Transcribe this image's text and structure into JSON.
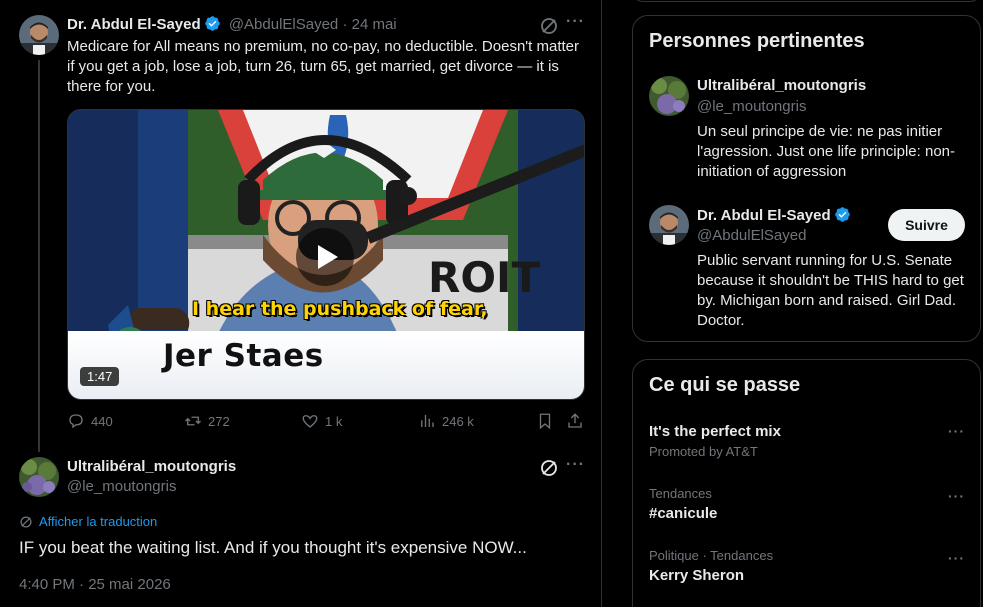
{
  "post1": {
    "author_name": "Dr. Abdul El-Sayed",
    "author_handle": "@AbdulElSayed",
    "date": "· 24 mai",
    "text": "Medicare for All means no premium, no co-pay, no deductible. Doesn't matter if you get a job, lose a job, turn 26, turn 65, get married, get divorce — it is there for you.",
    "video": {
      "caption": "I hear the pushback of fear,",
      "lower_third_name": "Jer Staes",
      "backdrop_text": "ROIT",
      "duration": "1:47"
    },
    "actions": {
      "replies": "440",
      "reposts": "272",
      "likes": "1 k",
      "views": "246 k"
    }
  },
  "post2": {
    "author_name": "Ultralibéral_moutongris",
    "author_handle": "@le_moutongris",
    "translate_label": "Afficher la traduction",
    "text": "IF you beat the waiting list. And if you thought it's expensive NOW...",
    "timestamp": "4:40 PM · 25 mai 2026"
  },
  "relevant_people": {
    "title": "Personnes pertinentes",
    "people": [
      {
        "name": "Ultralibéral_moutongris",
        "handle": "@le_moutongris",
        "bio": "Un seul principe de vie: ne pas initier l'agression. Just one life principle: non-initiation of aggression"
      },
      {
        "name": "Dr. Abdul El-Sayed",
        "handle": "@AbdulElSayed",
        "bio": "Public servant running for U.S. Senate because it shouldn't be THIS hard to get by. Michigan born and raised. Girl Dad. Doctor.",
        "follow_label": "Suivre"
      }
    ]
  },
  "trending": {
    "title": "Ce qui se passe",
    "items": [
      {
        "title": "It's the perfect mix",
        "meta": "Promoted by AT&T"
      },
      {
        "meta": "Tendances",
        "title": "#canicule"
      },
      {
        "meta": "Politique · Tendances",
        "title": "Kerry Sheron"
      }
    ]
  },
  "colors": {
    "accent": "#1d9bf0",
    "muted": "#71767b",
    "border": "#2f3336",
    "caption_yellow": "#ffd400"
  },
  "icons": [
    "verified-badge-icon",
    "grok-icon",
    "more-icon",
    "reply-icon",
    "repost-icon",
    "like-icon",
    "views-icon",
    "bookmark-icon",
    "share-icon",
    "translate-icon",
    "play-icon"
  ]
}
